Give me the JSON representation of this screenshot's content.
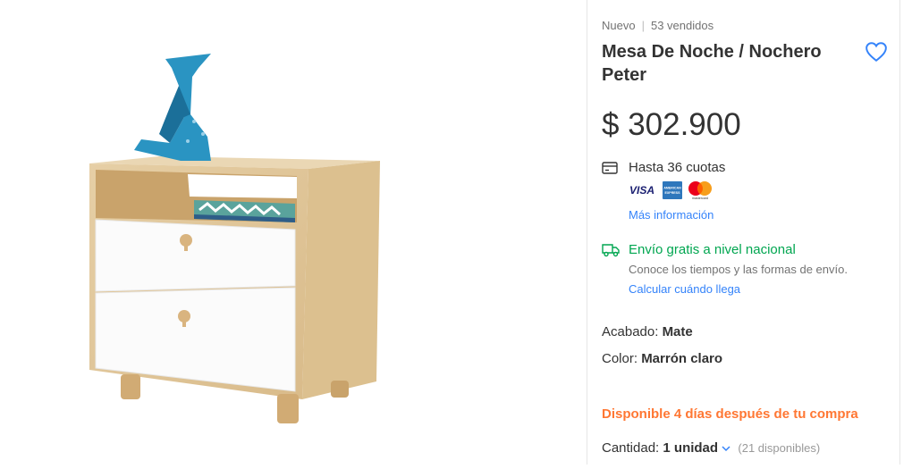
{
  "product": {
    "condition": "Nuevo",
    "sold": "53 vendidos",
    "title": "Mesa De Noche / Nochero Peter",
    "price": "$ 302.900"
  },
  "payment": {
    "installments": "Hasta 36 cuotas",
    "cards": [
      "VISA",
      "AMERICAN EXPRESS",
      "mastercard"
    ],
    "more_info": "Más información"
  },
  "shipping": {
    "title": "Envío gratis a nivel nacional",
    "desc": "Conoce los tiempos y las formas de envío.",
    "calc_link": "Calcular cuándo llega"
  },
  "attributes": [
    {
      "label": "Acabado:",
      "value": "Mate"
    },
    {
      "label": "Color:",
      "value": "Marrón claro"
    }
  ],
  "availability": "Disponible 4 días después de tu compra",
  "quantity": {
    "label": "Cantidad:",
    "selected": "1 unidad",
    "available": "(21 disponibles)"
  },
  "colors": {
    "link": "#3483fa",
    "shipping": "#00a650",
    "availability": "#ff7733"
  },
  "icons": [
    "heart-icon",
    "credit-card-icon",
    "truck-icon",
    "chevron-down-icon"
  ]
}
